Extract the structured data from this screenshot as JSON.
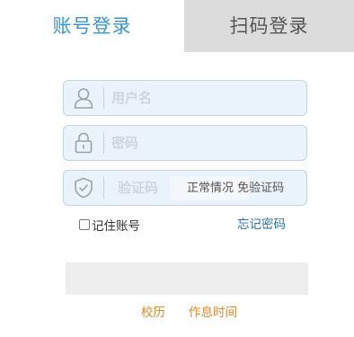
{
  "tabs": {
    "account_login": "账号登录",
    "qr_login": "扫码登录"
  },
  "form": {
    "username_placeholder": "用户名",
    "password_placeholder": "密码",
    "captcha_placeholder": "验证码",
    "captcha_hint": "正常情况 免验证码",
    "remember_label": "记住账号",
    "forgot_link": "忘记密码",
    "submit_label": ""
  },
  "footer": {
    "calendar_link": "校历",
    "schedule_link": "作息时间"
  },
  "icons": {
    "username": "user-icon",
    "password": "lock-icon",
    "captcha": "shield-check-icon"
  },
  "colors": {
    "active_tab_text": "#3a96c8",
    "inactive_tab_bg": "#dcdcdc",
    "field_bg": "#eaf3fb",
    "link_blue": "#2a6fa8",
    "link_orange": "#e0882d"
  }
}
